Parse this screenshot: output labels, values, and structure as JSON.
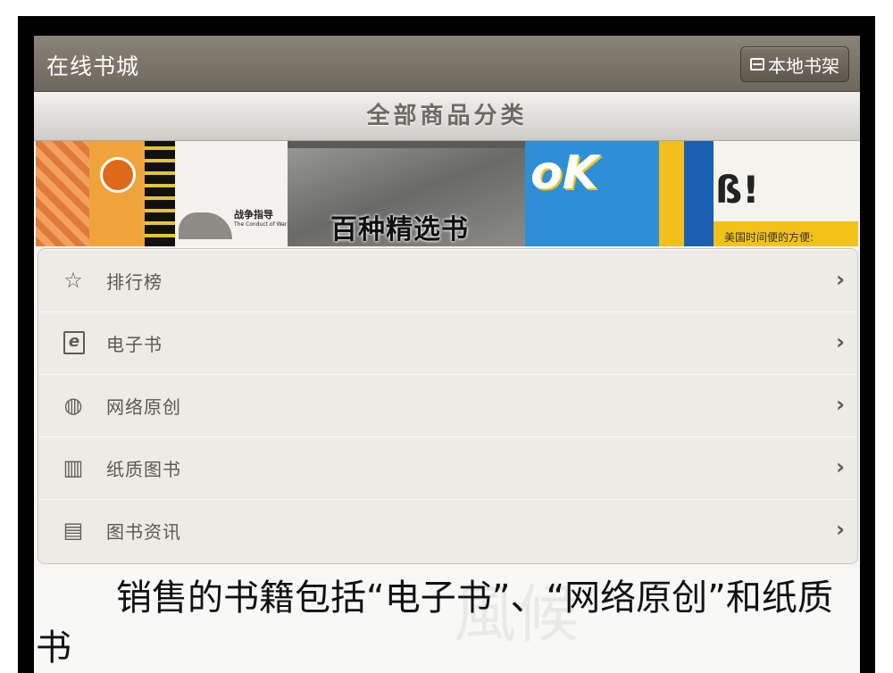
{
  "app": {
    "title": "在线书城",
    "shelf_button": "本地书架"
  },
  "category_header": "全部商品分类",
  "banner": {
    "book_title": "战争指导",
    "book_subtitle": "The Conduct of War",
    "promo_text": "百种精选书",
    "logo_text": "oK",
    "exclaim_text": "ß!",
    "sub_text": "美国时间便的方便:"
  },
  "menu": {
    "items": [
      {
        "label": "排行榜",
        "icon": "star-icon",
        "glyph": "☆"
      },
      {
        "label": "电子书",
        "icon": "ebook-icon",
        "glyph": "e"
      },
      {
        "label": "网络原创",
        "icon": "globe-icon",
        "glyph": "◍"
      },
      {
        "label": "纸质图书",
        "icon": "open-book-icon",
        "glyph": "▥"
      },
      {
        "label": "图书资讯",
        "icon": "document-icon",
        "glyph": "▤"
      }
    ],
    "chevron": "›"
  },
  "caption": {
    "text": "销售的书籍包括“电子书”、“网络原创”和纸质书",
    "watermark": "風候"
  }
}
